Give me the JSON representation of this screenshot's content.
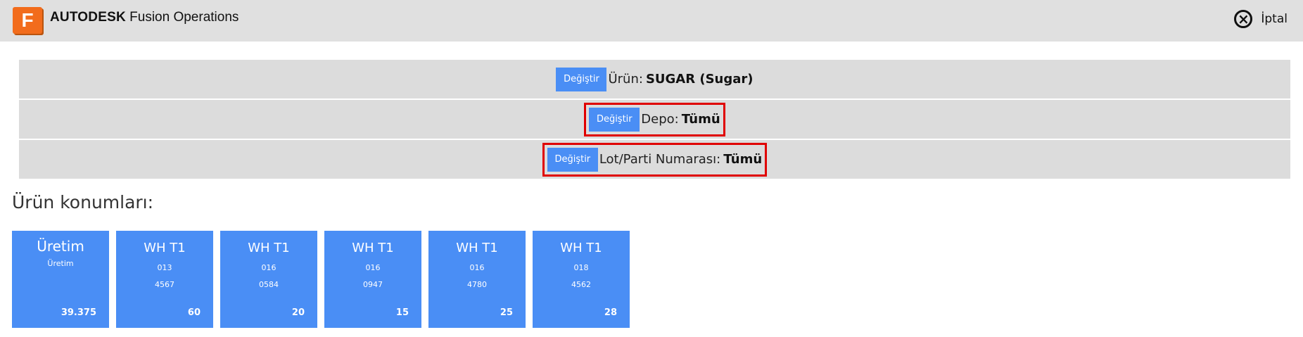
{
  "app": {
    "logo_letter": "F",
    "brand_bold": "AUTODESK",
    "brand_rest": "Fusion Operations",
    "cancel_label": "İptal"
  },
  "filters": [
    {
      "button": "Değiştir",
      "label": "Ürün:",
      "value": "SUGAR (Sugar)",
      "highlighted": false
    },
    {
      "button": "Değiştir",
      "label": "Depo:",
      "value": "Tümü",
      "highlighted": true
    },
    {
      "button": "Değiştir",
      "label": "Lot/Parti Numarası:",
      "value": "Tümü",
      "highlighted": true
    }
  ],
  "section_title": "Ürün konumları:",
  "locations": [
    {
      "title": "Üretim",
      "line1": "Üretim",
      "line2": "",
      "qty": "39.375"
    },
    {
      "title": "WH T1",
      "line1": "013",
      "line2": "4567",
      "qty": "60"
    },
    {
      "title": "WH T1",
      "line1": "016",
      "line2": "0584",
      "qty": "20"
    },
    {
      "title": "WH T1",
      "line1": "016",
      "line2": "0947",
      "qty": "15"
    },
    {
      "title": "WH T1",
      "line1": "016",
      "line2": "4780",
      "qty": "25"
    },
    {
      "title": "WH T1",
      "line1": "018",
      "line2": "4562",
      "qty": "28"
    }
  ],
  "colors": {
    "accent": "#4a8ef5",
    "logo": "#f26c1c",
    "highlight": "#e00000"
  }
}
